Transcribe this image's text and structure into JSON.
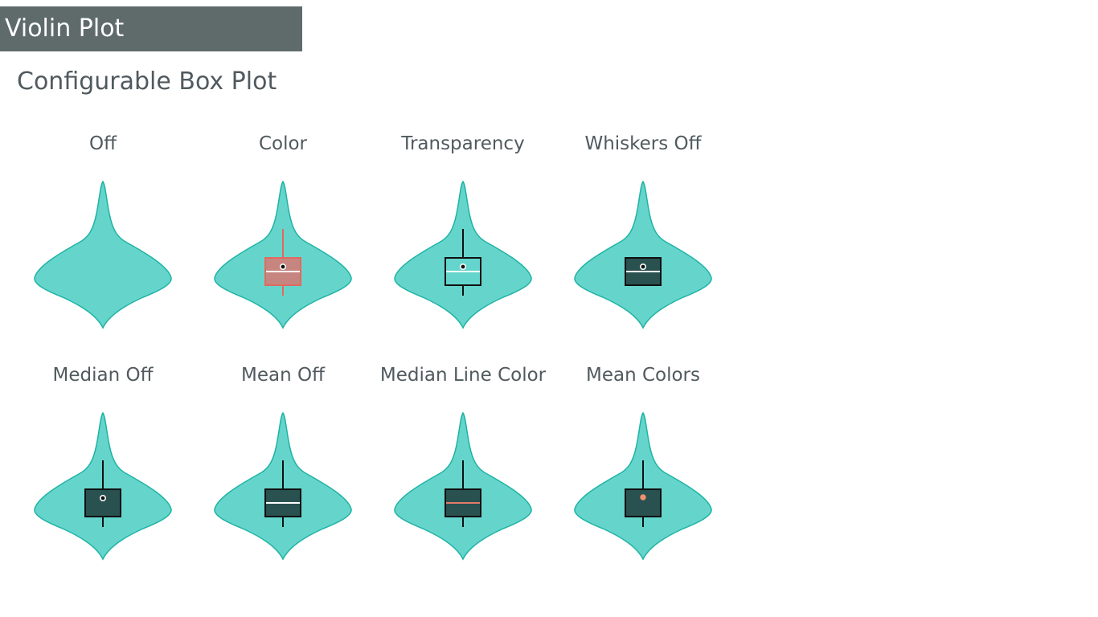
{
  "window_title": "Violin Plot",
  "section_title": "Configurable Box Plot",
  "colors": {
    "violin_fill": "#65d5cc",
    "violin_stroke": "#1fb3a4",
    "box_fill_dark": "#285150",
    "box_stroke": "#111111",
    "title_bar_bg": "#5f6b6b",
    "text": "#505a5e",
    "box_color_variant": "#c7857f",
    "box_color_variant_stroke": "#e06a60",
    "median_line_color": "#e57a6e",
    "mean_marker_color": "#f0906f"
  },
  "panels": [
    {
      "label": "Off",
      "box": false
    },
    {
      "label": "Color",
      "box": true,
      "whiskers": true,
      "median": true,
      "mean": true,
      "style": "color"
    },
    {
      "label": "Transparency",
      "box": true,
      "whiskers": true,
      "median": true,
      "mean": true,
      "style": "transparent"
    },
    {
      "label": "Whiskers Off",
      "box": true,
      "whiskers": false,
      "median": true,
      "mean": true,
      "style": "dark"
    },
    {
      "label": "Median Off",
      "box": true,
      "whiskers": true,
      "median": false,
      "mean": true,
      "style": "dark"
    },
    {
      "label": "Mean Off",
      "box": true,
      "whiskers": true,
      "median": true,
      "mean": false,
      "style": "dark"
    },
    {
      "label": "Median Line Color",
      "box": true,
      "whiskers": true,
      "median": true,
      "mean": false,
      "style": "dark",
      "median_colored": true
    },
    {
      "label": "Mean Colors",
      "box": true,
      "whiskers": true,
      "median": false,
      "mean": true,
      "style": "dark",
      "mean_colored": true
    }
  ]
}
